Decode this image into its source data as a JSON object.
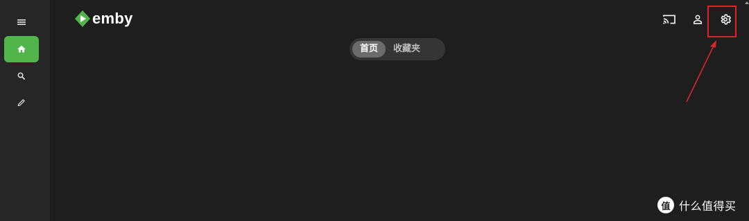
{
  "app": {
    "brand_name": "emby",
    "brand_color": "#52b54b",
    "background_color": "#1e1e1e",
    "sidebar_color": "#262626"
  },
  "sidebar": {
    "items": [
      {
        "icon": "menu-icon",
        "active": false
      },
      {
        "icon": "home-icon",
        "active": true
      },
      {
        "icon": "search-icon",
        "active": false
      },
      {
        "icon": "edit-icon",
        "active": false
      }
    ]
  },
  "header": {
    "icons": [
      "cast-icon",
      "user-icon",
      "settings-icon"
    ]
  },
  "tabs": [
    {
      "label": "首页",
      "active": true
    },
    {
      "label": "收藏夹",
      "active": false
    }
  ],
  "annotation": {
    "highlight_color": "#d9262c",
    "target": "settings-icon"
  },
  "watermark": {
    "badge": "值",
    "text": "什么值得买"
  }
}
